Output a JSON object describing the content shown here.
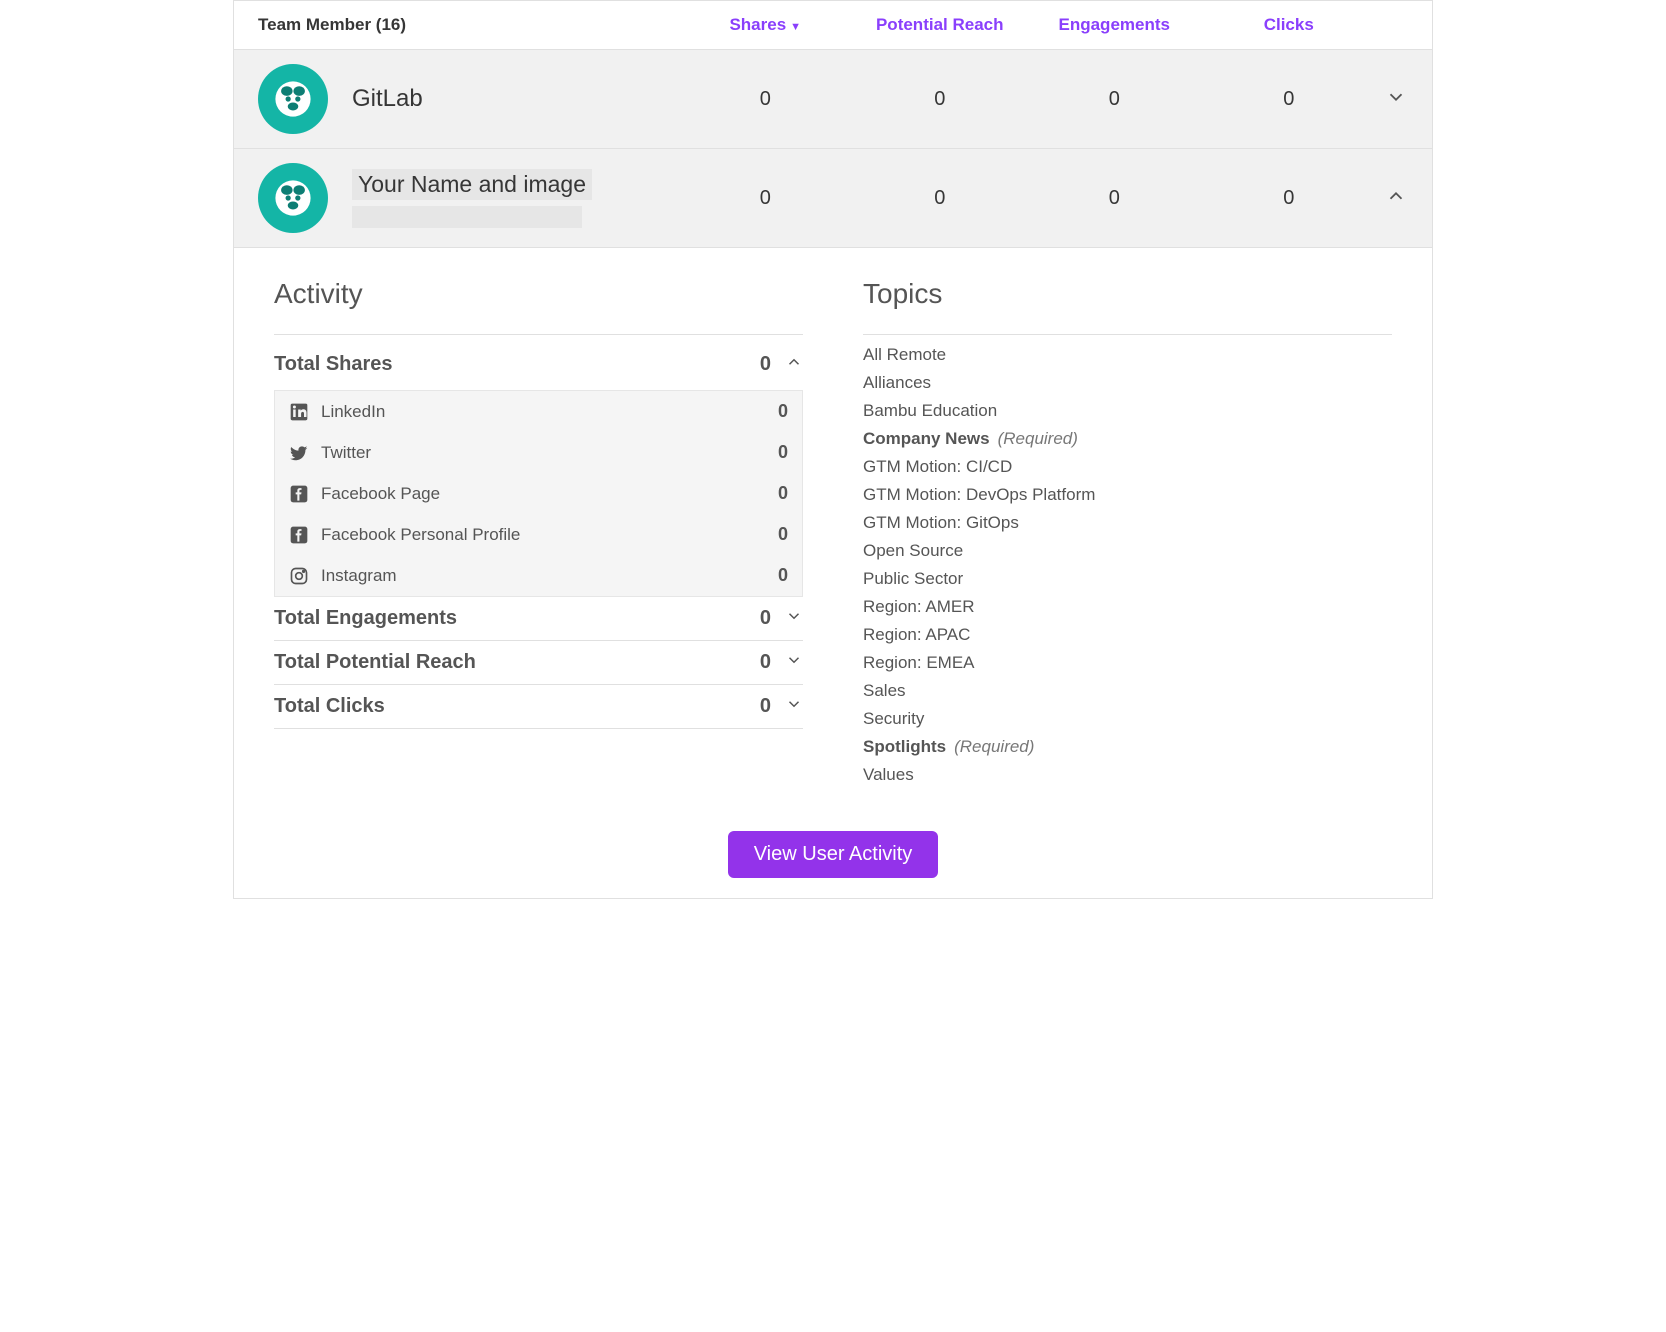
{
  "header": {
    "team_member_label": "Team Member (16)",
    "shares": "Shares",
    "potential_reach": "Potential Reach",
    "engagements": "Engagements",
    "clicks": "Clicks"
  },
  "members": [
    {
      "name": "GitLab",
      "shares": "0",
      "reach": "0",
      "engagements": "0",
      "clicks": "0",
      "expanded": false
    },
    {
      "name": "Your Name and image",
      "shares": "0",
      "reach": "0",
      "engagements": "0",
      "clicks": "0",
      "expanded": true
    }
  ],
  "activity": {
    "heading": "Activity",
    "total_shares": {
      "label": "Total Shares",
      "value": "0"
    },
    "share_items": [
      {
        "icon": "linkedin",
        "label": "LinkedIn",
        "value": "0"
      },
      {
        "icon": "twitter",
        "label": "Twitter",
        "value": "0"
      },
      {
        "icon": "facebook",
        "label": "Facebook Page",
        "value": "0"
      },
      {
        "icon": "facebook",
        "label": "Facebook Personal Profile",
        "value": "0"
      },
      {
        "icon": "instagram",
        "label": "Instagram",
        "value": "0"
      }
    ],
    "total_engagements": {
      "label": "Total Engagements",
      "value": "0"
    },
    "total_potential_reach": {
      "label": "Total Potential Reach",
      "value": "0"
    },
    "total_clicks": {
      "label": "Total Clicks",
      "value": "0"
    }
  },
  "topics": {
    "heading": "Topics",
    "items": [
      {
        "name": "All Remote",
        "required": false
      },
      {
        "name": "Alliances",
        "required": false
      },
      {
        "name": "Bambu Education",
        "required": false
      },
      {
        "name": "Company News",
        "required": true
      },
      {
        "name": "GTM Motion: CI/CD",
        "required": false
      },
      {
        "name": "GTM Motion: DevOps Platform",
        "required": false
      },
      {
        "name": "GTM Motion: GitOps",
        "required": false
      },
      {
        "name": "Open Source",
        "required": false
      },
      {
        "name": "Public Sector",
        "required": false
      },
      {
        "name": "Region: AMER",
        "required": false
      },
      {
        "name": "Region: APAC",
        "required": false
      },
      {
        "name": "Region: EMEA",
        "required": false
      },
      {
        "name": "Sales",
        "required": false
      },
      {
        "name": "Security",
        "required": false
      },
      {
        "name": "Spotlights",
        "required": true
      },
      {
        "name": "Values",
        "required": false
      }
    ],
    "required_label": "(Required)"
  },
  "action_button": "View User Activity"
}
